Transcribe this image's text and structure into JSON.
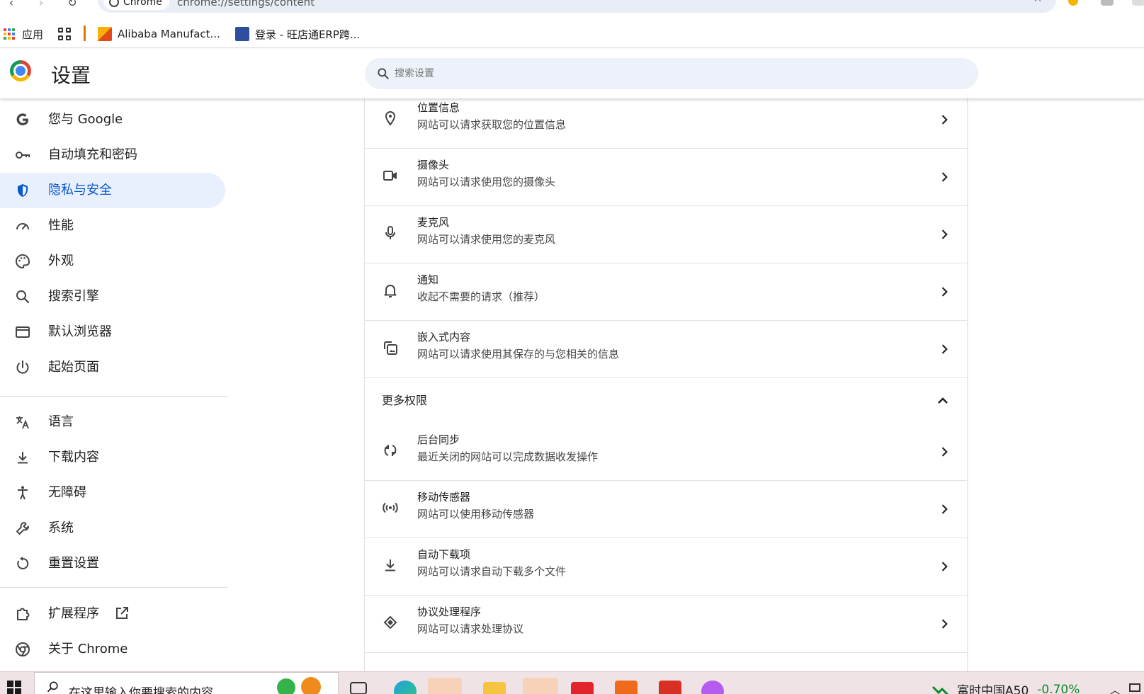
{
  "browser": {
    "tab_chip_label": "Chrome",
    "url": "chrome://settings/content"
  },
  "bookmarks": [
    {
      "label": "应用"
    },
    {
      "label": ""
    },
    {
      "label": "Alibaba Manufact..."
    },
    {
      "label": "登录 - 旺店通ERP跨..."
    }
  ],
  "header": {
    "title": "设置",
    "search_placeholder": "搜索设置"
  },
  "sidebar": {
    "items": [
      {
        "label": "您与 Google",
        "icon": "google-g-icon"
      },
      {
        "label": "自动填充和密码",
        "icon": "key-icon"
      },
      {
        "label": "隐私与安全",
        "icon": "shield-icon",
        "active": true
      },
      {
        "label": "性能",
        "icon": "speedometer-icon"
      },
      {
        "label": "外观",
        "icon": "palette-icon"
      },
      {
        "label": "搜索引擎",
        "icon": "search-icon"
      },
      {
        "label": "默认浏览器",
        "icon": "browser-window-icon"
      },
      {
        "label": "起始页面",
        "icon": "power-icon"
      },
      {
        "label": "语言",
        "icon": "translate-icon"
      },
      {
        "label": "下载内容",
        "icon": "download-icon"
      },
      {
        "label": "无障碍",
        "icon": "accessibility-icon"
      },
      {
        "label": "系统",
        "icon": "wrench-icon"
      },
      {
        "label": "重置设置",
        "icon": "reset-icon"
      },
      {
        "label": "扩展程序",
        "icon": "puzzle-icon"
      },
      {
        "label": "关于 Chrome",
        "icon": "chrome-icon"
      }
    ]
  },
  "content": {
    "rows_top": [
      {
        "title": "位置信息",
        "subtitle": "网站可以请求获取您的位置信息",
        "icon": "location-pin-icon"
      },
      {
        "title": "摄像头",
        "subtitle": "网站可以请求使用您的摄像头",
        "icon": "camera-icon"
      },
      {
        "title": "麦克风",
        "subtitle": "网站可以请求使用您的麦克风",
        "icon": "microphone-icon"
      },
      {
        "title": "通知",
        "subtitle": "收起不需要的请求（推荐）",
        "icon": "bell-icon"
      },
      {
        "title": "嵌入式内容",
        "subtitle": "网站可以请求使用其保存的与您相关的信息",
        "icon": "embedded-content-icon"
      }
    ],
    "more_permissions_label": "更多权限",
    "rows_more": [
      {
        "title": "后台同步",
        "subtitle": "最近关闭的网站可以完成数据收发操作",
        "icon": "sync-icon"
      },
      {
        "title": "移动传感器",
        "subtitle": "网站可以使用移动传感器",
        "icon": "sensor-icon"
      },
      {
        "title": "自动下载项",
        "subtitle": "网站可以请求自动下载多个文件",
        "icon": "download-icon"
      },
      {
        "title": "协议处理程序",
        "subtitle": "网站可以请求处理协议",
        "icon": "protocol-handler-icon"
      }
    ]
  },
  "taskbar": {
    "search_text": "在这里输入你要搜索的内容",
    "stock_name": "富时中国A50",
    "stock_change": "-0.70%"
  },
  "colors": {
    "accent": "#0b57d0",
    "active_bg": "#e8f0fe",
    "search_bg": "#edf2fa",
    "stock_green": "#0a8a2e"
  }
}
